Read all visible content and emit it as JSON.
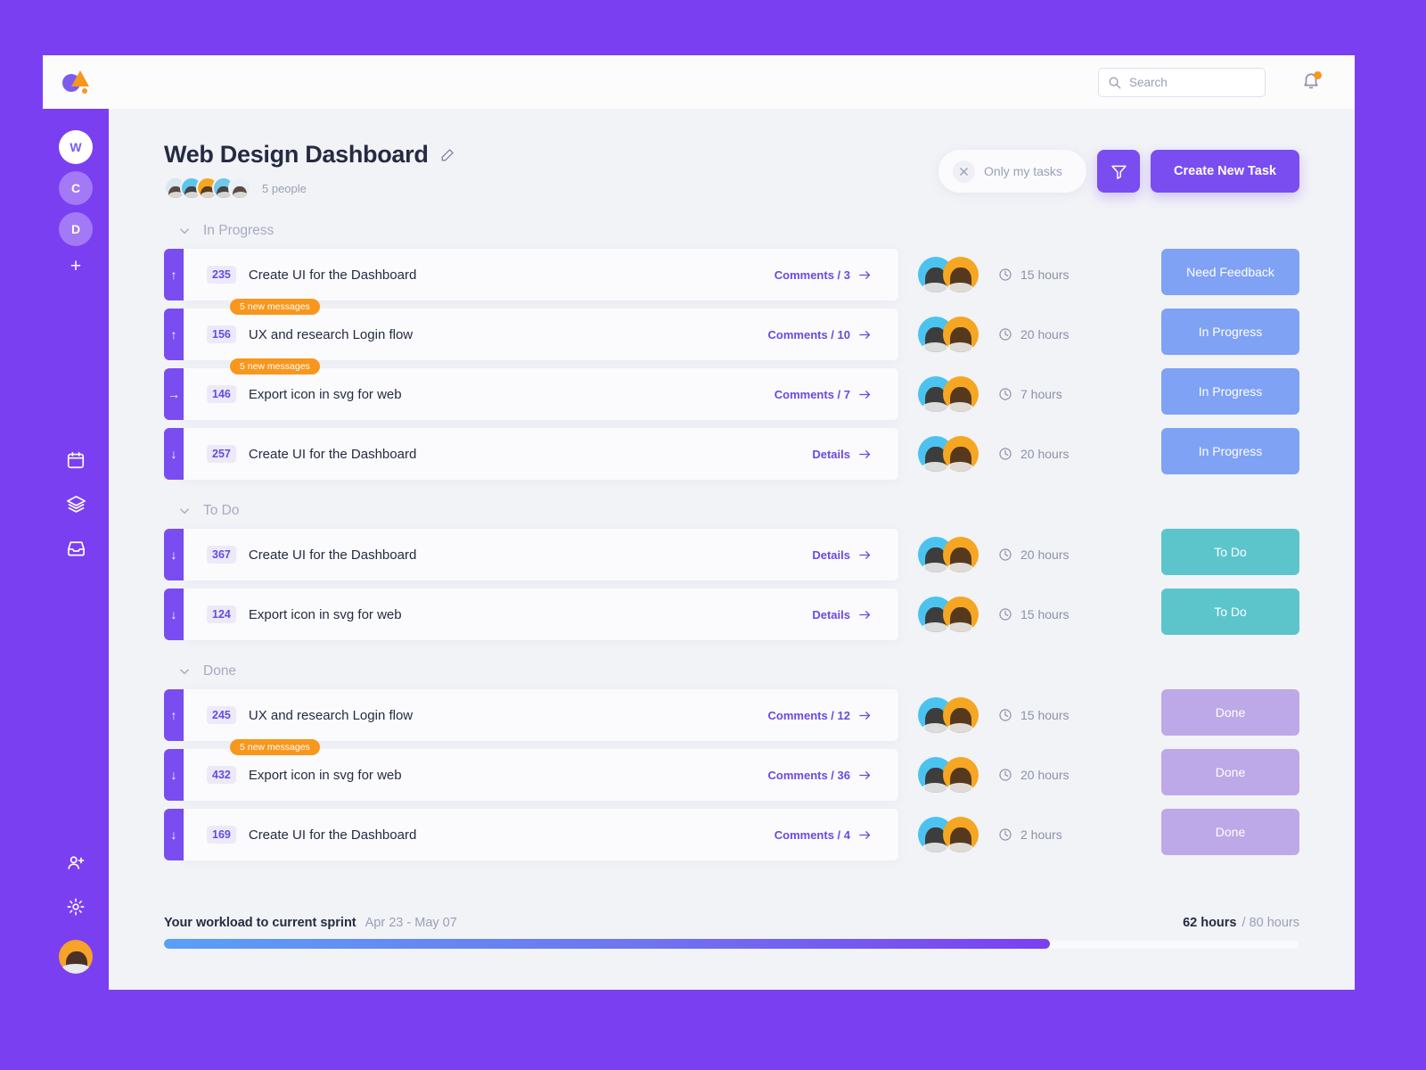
{
  "topbar": {
    "logo_name": "app-logo",
    "search": {
      "placeholder": "Search",
      "value": ""
    },
    "notifications_icon": "bell-icon",
    "has_notification_dot": true
  },
  "sidebar": {
    "workspaces": [
      {
        "label": "W",
        "active": true
      },
      {
        "label": "C",
        "active": false
      },
      {
        "label": "D",
        "active": false
      }
    ],
    "add_workspace_label": "+",
    "nav": [
      {
        "icon": "calendar-icon"
      },
      {
        "icon": "layers-icon"
      },
      {
        "icon": "inbox-icon"
      }
    ],
    "bottom": [
      {
        "icon": "add-user-icon"
      },
      {
        "icon": "gear-icon"
      }
    ],
    "profile_avatar": "user-avatar"
  },
  "header": {
    "title": "Web Design Dashboard",
    "edit_icon": "edit-icon",
    "people_count": "5 people",
    "avatar_colors": [
      "#d9e7f2",
      "#5ec3ec",
      "#f5a623",
      "#6fc7ea",
      "#eaf0f5"
    ],
    "only_my_tasks": "Only my tasks",
    "filter_icon": "filter-icon",
    "create_task": "Create New Task"
  },
  "colors": {
    "brand_purple": "#7B3FF2",
    "accent_purple": "#7a4df0",
    "orange": "#f7971d",
    "status_blue": "#7fa2f5",
    "status_teal": "#5cc5cc",
    "status_done": "#bda8e8"
  },
  "sections": [
    {
      "name": "In Progress",
      "tasks": [
        {
          "id": "235",
          "title": "Create UI for the Dashboard",
          "priority": "up",
          "link": "Comments / 3",
          "badge": null,
          "hours": "15 hours",
          "status": "Need Feedback",
          "status_class": "st-feedback"
        },
        {
          "id": "156",
          "title": "UX and research Login flow",
          "priority": "up",
          "link": "Comments / 10",
          "badge": "5 new messages",
          "hours": "20 hours",
          "status": "In Progress",
          "status_class": "st-progress"
        },
        {
          "id": "146",
          "title": "Export icon in svg for web",
          "priority": "right",
          "link": "Comments / 7",
          "badge": "5 new messages",
          "hours": "7 hours",
          "status": "In Progress",
          "status_class": "st-progress"
        },
        {
          "id": "257",
          "title": "Create UI for the Dashboard",
          "priority": "down",
          "link": "Details",
          "badge": null,
          "hours": "20 hours",
          "status": "In Progress",
          "status_class": "st-progress"
        }
      ]
    },
    {
      "name": "To Do",
      "tasks": [
        {
          "id": "367",
          "title": "Create UI for the Dashboard",
          "priority": "down",
          "link": "Details",
          "badge": null,
          "hours": "20 hours",
          "status": "To Do",
          "status_class": "st-todo"
        },
        {
          "id": "124",
          "title": "Export icon in svg for web",
          "priority": "down",
          "link": "Details",
          "badge": null,
          "hours": "15 hours",
          "status": "To Do",
          "status_class": "st-todo"
        }
      ]
    },
    {
      "name": "Done",
      "tasks": [
        {
          "id": "245",
          "title": "UX and research Login flow",
          "priority": "up",
          "link": "Comments / 12",
          "badge": null,
          "hours": "15 hours",
          "status": "Done",
          "status_class": "st-done"
        },
        {
          "id": "432",
          "title": "Export icon in svg for web",
          "priority": "down",
          "link": "Comments / 36",
          "badge": "5 new messages",
          "hours": "20 hours",
          "status": "Done",
          "status_class": "st-done"
        },
        {
          "id": "169",
          "title": "Create UI for the Dashboard",
          "priority": "down",
          "link": "Comments / 4",
          "badge": null,
          "hours": "2 hours",
          "status": "Done",
          "status_class": "st-done"
        }
      ]
    }
  ],
  "footer": {
    "label": "Your workload to current sprint",
    "date_range": "Apr 23 - May 07",
    "hours_used": "62 hours",
    "hours_total": "/ 80 hours",
    "progress_percent": 78
  }
}
